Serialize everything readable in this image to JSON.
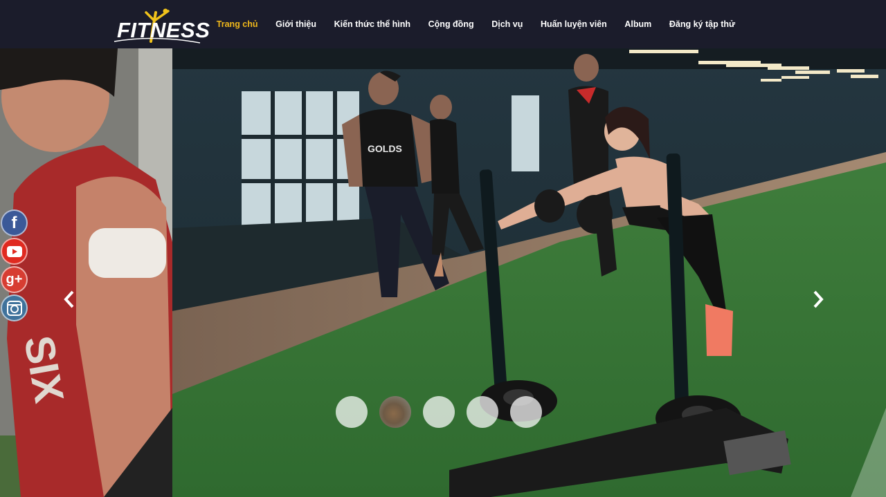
{
  "brand": {
    "logo_text": "FITNESS",
    "accent_color": "#f0b81b"
  },
  "nav": {
    "items": [
      {
        "label": "Trang chủ",
        "active": true
      },
      {
        "label": "Giới thiệu"
      },
      {
        "label": "Kiến thức thể hình"
      },
      {
        "label": "Cộng đồng"
      },
      {
        "label": "Dịch vụ"
      },
      {
        "label": "Huấn luyện viên"
      },
      {
        "label": "Album"
      },
      {
        "label": "Đăng ký tập thử"
      }
    ]
  },
  "social": {
    "items": [
      {
        "icon": "facebook-icon",
        "glyph": "f",
        "color": "#3b5998"
      },
      {
        "icon": "youtube-icon",
        "color": "#e02a20"
      },
      {
        "icon": "google-plus-icon",
        "glyph": "g+",
        "color": "#d73d32"
      },
      {
        "icon": "instagram-icon",
        "color": "#3f729b"
      }
    ]
  },
  "slider": {
    "slide_count": 5,
    "active_slide": 2,
    "prev_icon": "chevron-left-icon",
    "next_icon": "chevron-right-icon"
  }
}
